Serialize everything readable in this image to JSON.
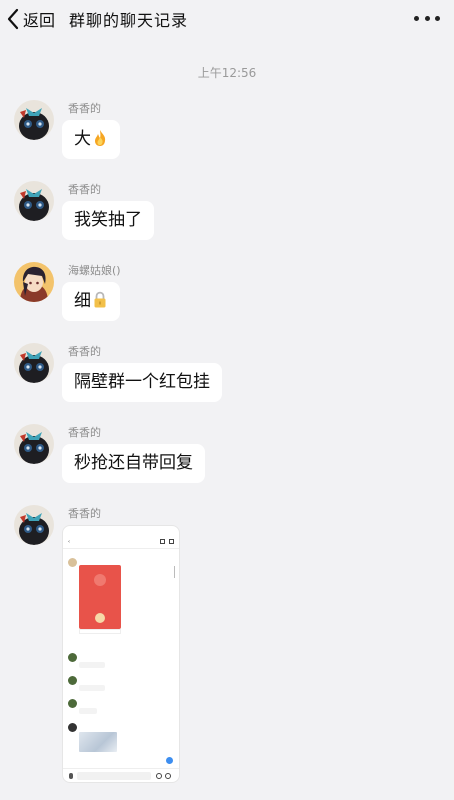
{
  "header": {
    "back_label": "返回",
    "title": "群聊的聊天记录"
  },
  "timestamp": "上午12:56",
  "messages": [
    {
      "sender": "香香的",
      "text": "大",
      "emoji": "fire-icon",
      "avatar": "black-cat"
    },
    {
      "sender": "香香的",
      "text": "我笑抽了",
      "avatar": "black-cat"
    },
    {
      "sender": "海螺姑娘()",
      "text": "细",
      "emoji": "lock-icon",
      "avatar": "anime-girl"
    },
    {
      "sender": "香香的",
      "text": "隔壁群一个红包挂",
      "avatar": "black-cat"
    },
    {
      "sender": "香香的",
      "text": "秒抢还自带回复",
      "avatar": "black-cat"
    },
    {
      "sender": "香香的",
      "type": "screenshot-image",
      "avatar": "black-cat"
    }
  ],
  "colors": {
    "background": "#f2f2f4",
    "bubble": "#ffffff",
    "red_packet": "#e8534a",
    "accent_blue": "#3d8ef0"
  }
}
